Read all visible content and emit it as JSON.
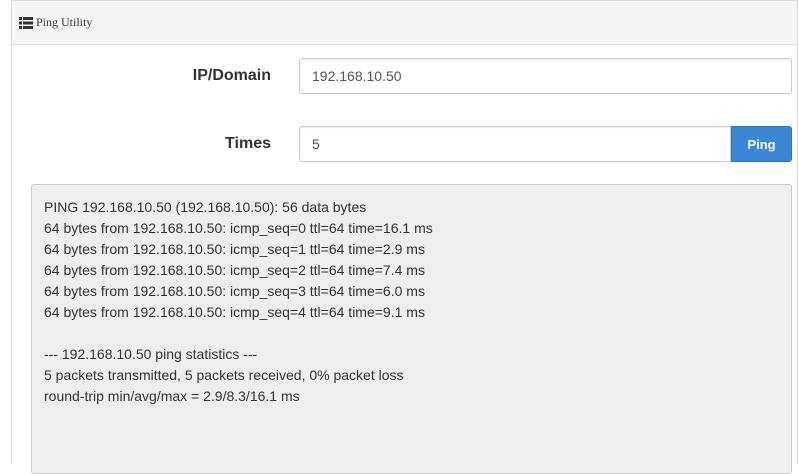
{
  "panel": {
    "title": "Ping Utility",
    "title_icon": "list-icon"
  },
  "form": {
    "ip_label": "IP/Domain",
    "ip_value": "192.168.10.50",
    "times_label": "Times",
    "times_value": "5",
    "ping_button_label": "Ping"
  },
  "output": {
    "lines": [
      "PING 192.168.10.50 (192.168.10.50): 56 data bytes",
      "64 bytes from 192.168.10.50: icmp_seq=0 ttl=64 time=16.1 ms",
      "64 bytes from 192.168.10.50: icmp_seq=1 ttl=64 time=2.9 ms",
      "64 bytes from 192.168.10.50: icmp_seq=2 ttl=64 time=7.4 ms",
      "64 bytes from 192.168.10.50: icmp_seq=3 ttl=64 time=6.0 ms",
      "64 bytes from 192.168.10.50: icmp_seq=4 ttl=64 time=9.1 ms",
      "",
      "--- 192.168.10.50 ping statistics ---",
      "5 packets transmitted, 5 packets received, 0% packet loss",
      "round-trip min/avg/max = 2.9/8.3/16.1 ms"
    ]
  },
  "colors": {
    "accent": "#3a87d6",
    "heading_bg": "#f5f5f5",
    "output_bg": "#eeeeee"
  }
}
